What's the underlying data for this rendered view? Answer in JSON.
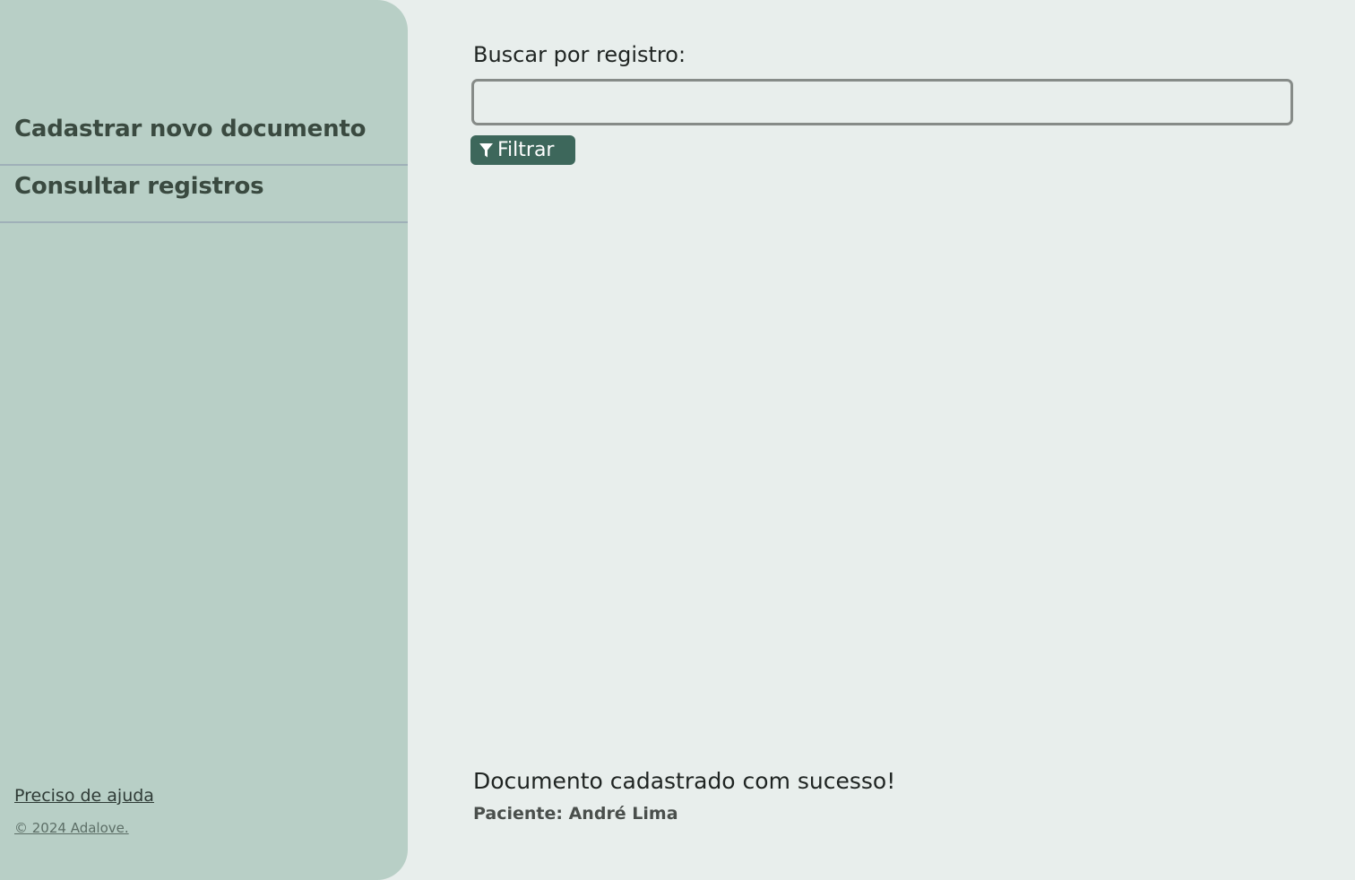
{
  "sidebar": {
    "items": [
      {
        "label": "Cadastrar novo documento"
      },
      {
        "label": "Consultar registros"
      }
    ],
    "help_link": "Preciso de ajuda",
    "copyright": "© 2024 Adalove."
  },
  "search": {
    "label": "Buscar por registro:",
    "value": "",
    "placeholder": ""
  },
  "filter_button": {
    "label": "Filtrar",
    "icon": "filter-icon"
  },
  "message": {
    "title": "Documento cadastrado com sucesso!",
    "subtitle": "Paciente: André Lima"
  },
  "colors": {
    "sidebar_bg": "#b8cfc6",
    "page_bg": "#e8eeec",
    "accent": "#3d675b"
  }
}
